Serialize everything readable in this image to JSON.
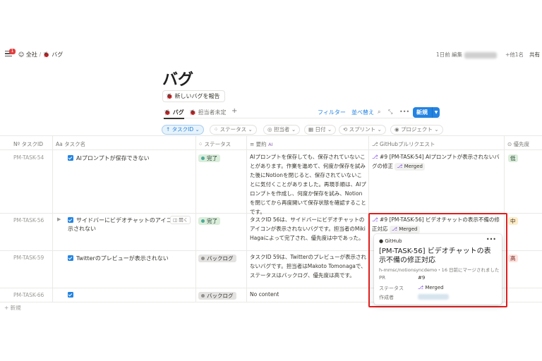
{
  "topbar": {
    "notif_count": "1",
    "crumb_root": "全社",
    "crumb_sep": "/",
    "crumb_page": "バグ",
    "edited": "1日前 編集",
    "others": "+他1名",
    "share": "共有"
  },
  "page": {
    "title": "バグ",
    "new_bug": "新しいバグを報告"
  },
  "tabs": [
    {
      "label": "バグ",
      "active": true
    },
    {
      "label": "担当者未定",
      "active": false
    }
  ],
  "toolbar": {
    "filter": "フィルター",
    "sort": "並べ替え",
    "new": "新規"
  },
  "filters": [
    "タスクID",
    "ステータス",
    "担当者",
    "日付",
    "スプリント",
    "プロジェクト"
  ],
  "columns": {
    "id": "タスクID",
    "name": "タスク名",
    "status": "ステータス",
    "summary": "要約",
    "github": "GitHubプルリクエスト",
    "priority": "優先度"
  },
  "rows": [
    {
      "id": "PM-TASK-54",
      "name": "AIプロンプトが保存できない",
      "status": "完了",
      "summary": "AIプロンプトを保存しても、保存されていないことがあります。作業を進めて、何度か保存を試みた後にNotionを閉じると、保存されていないことに気付くことがありました。再現手順は、AIプロンプトを作成し、何度か保存を試み、Notionを閉じてから再度開いて保存状態を確認することです。",
      "pr": "#9 [PM-TASK-54] AIプロンプトが表示されないバグの修正",
      "merged": "Merged",
      "priority": "低"
    },
    {
      "id": "PM-TASK-56",
      "name": "サイドバーにビデオチャットのアイコンが表示されない",
      "status": "完了",
      "summary": "タスクID 56は、サイドバーにビデオチャットのアイコンが表示されないバグです。担当者のMiki Hagaによって完了され、優先度は中であった。",
      "pr": "#9 [PM-TASK-56] ビデオチャットの表示不備の修正対応",
      "merged": "Merged",
      "priority": "中"
    },
    {
      "id": "PM-TASK-59",
      "name": "Twitterのプレビューが表示されない",
      "status": "バックログ",
      "summary": "タスクID 59は、Twitterのプレビューが表示されないバグです。担当者はMakoto Tomonagaで、ステータスはバックログ、優先度は高です。",
      "pr": "",
      "merged": "",
      "priority": "高"
    },
    {
      "id": "PM-TASK-66",
      "name": "",
      "status": "バックログ",
      "summary": "No content",
      "pr": "",
      "merged": "",
      "priority": ""
    }
  ],
  "open_label": "開く",
  "add_row": "新規",
  "popup": {
    "source": "GitHub",
    "title": "[PM-TASK-56] ビデオチャットの表示不備の修正対応",
    "meta": "h-mmsc/notionsyncdemo・16 日前にマージされました",
    "pr_label": "PR",
    "pr_value": "#9",
    "status_label": "ステータス",
    "status_value": "Merged",
    "author_label": "作成者",
    "menu": "•••"
  },
  "colors": {
    "accent": "#2383e2",
    "highlight_box": "#e01e1e",
    "done_bg": "#dbeddb",
    "backlog_bg": "#e3e2e0",
    "low_bg": "#dbeddb",
    "mid_bg": "#fdecc8",
    "high_bg": "#ffe2dd"
  }
}
